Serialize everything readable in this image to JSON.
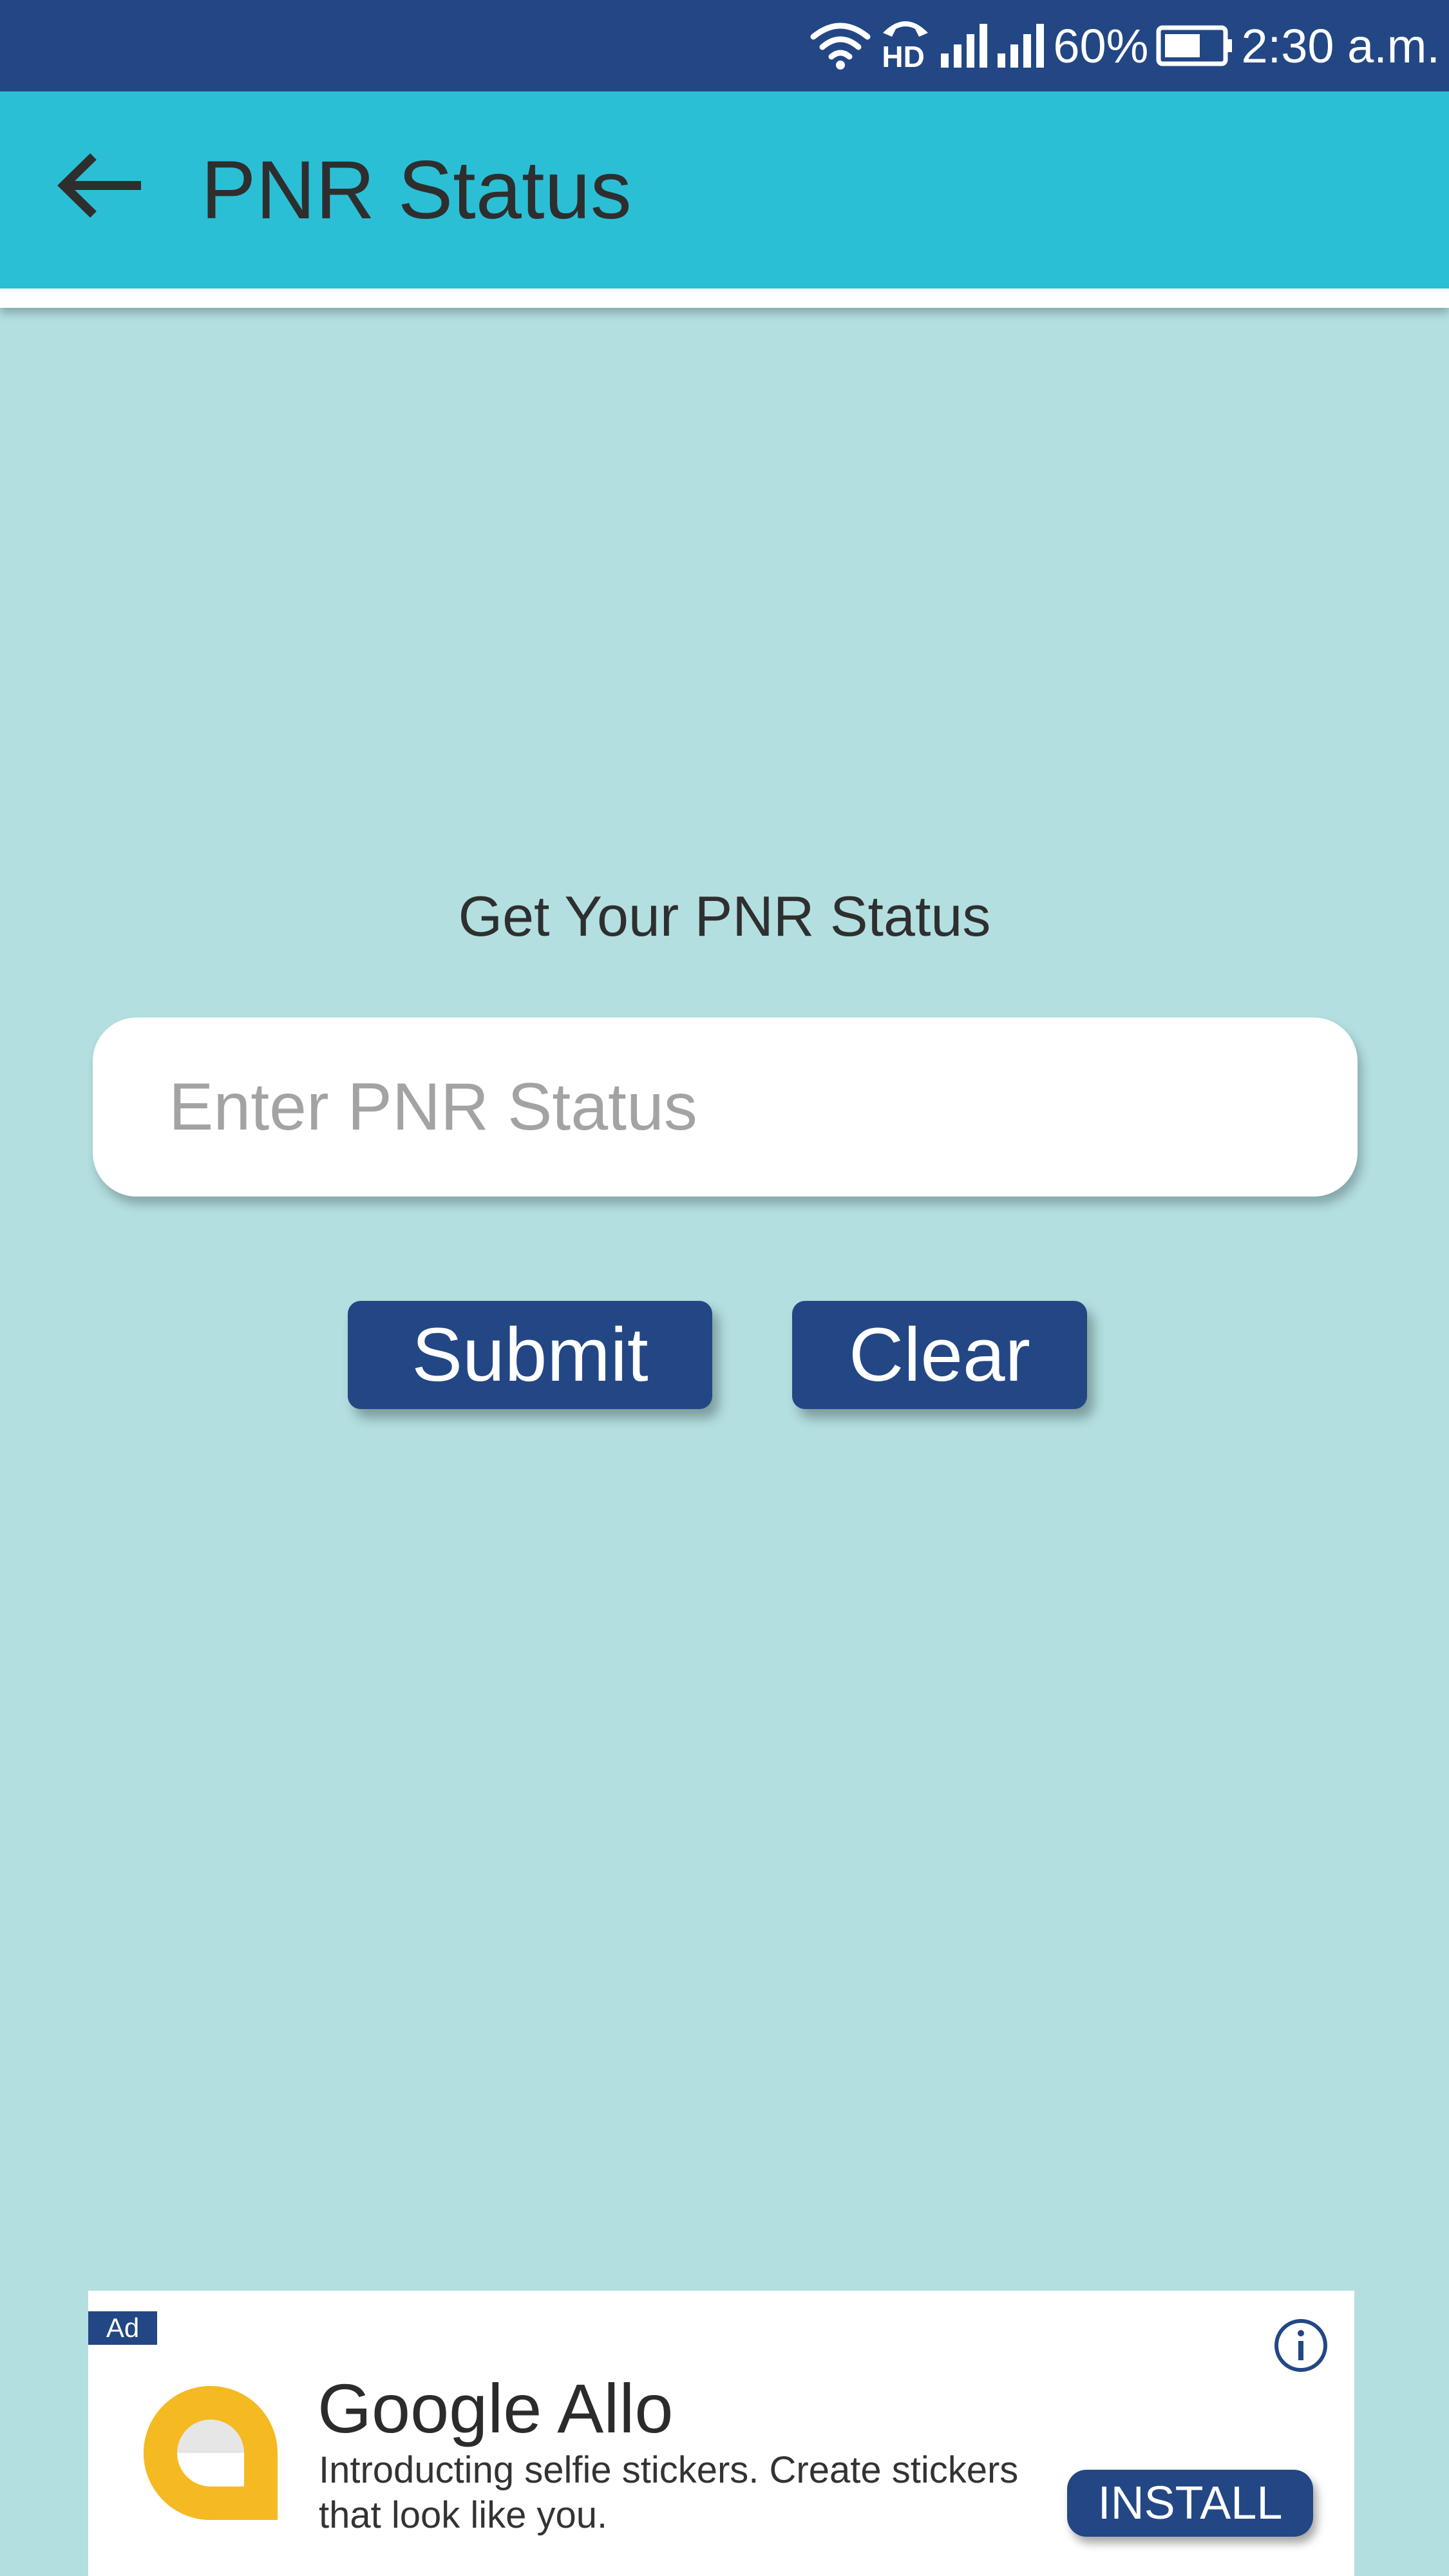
{
  "status_bar": {
    "battery_percent": "60%",
    "time": "2:30 a.m.",
    "hd_label": "HD",
    "icons": [
      "wifi-icon",
      "hd-call-icon",
      "signal-icon",
      "signal-icon",
      "battery-icon"
    ]
  },
  "app_bar": {
    "title": "PNR Status",
    "back_icon": "arrow-left-icon"
  },
  "main": {
    "heading": "Get Your PNR Status",
    "input": {
      "placeholder": "Enter PNR Status",
      "value": ""
    },
    "submit_label": "Submit",
    "clear_label": "Clear"
  },
  "ad": {
    "tag": "Ad",
    "title": "Google Allo",
    "description": "Introducting selfie stickers. Create stickers that look like you.",
    "install_label": "INSTALL",
    "info_icon": "info-icon",
    "logo_icon": "google-allo-logo-icon"
  },
  "colors": {
    "status_bar": "#234785",
    "app_bar": "#2bbfd6",
    "background": "#b3dfe0",
    "button": "#234785",
    "ad_logo_yellow": "#f5b922"
  }
}
